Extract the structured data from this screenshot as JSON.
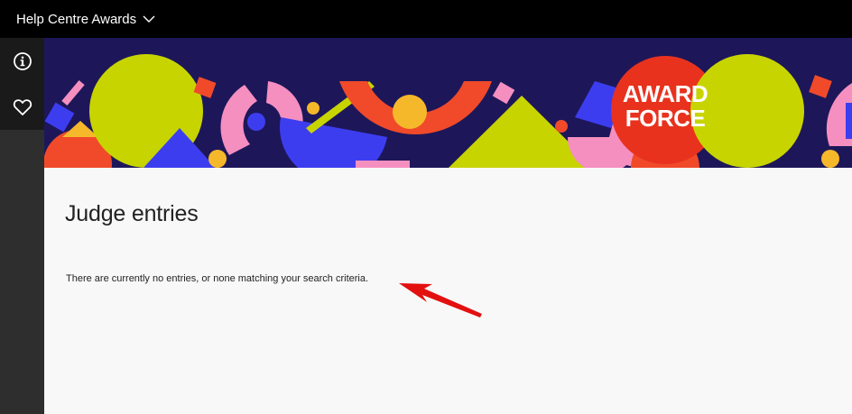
{
  "header": {
    "title": "Help Centre Awards"
  },
  "sidebar": {
    "items": [
      {
        "icon": "info-icon"
      },
      {
        "icon": "heart-icon"
      }
    ]
  },
  "banner": {
    "logo_line1": "AWARD",
    "logo_line2": "FORCE"
  },
  "main": {
    "title": "Judge entries",
    "empty_message": "There are currently no entries, or none matching your search criteria."
  },
  "colors": {
    "accent_red": "#e8321e",
    "banner_navy": "#1d1759",
    "annotation_arrow": "#e31010"
  }
}
